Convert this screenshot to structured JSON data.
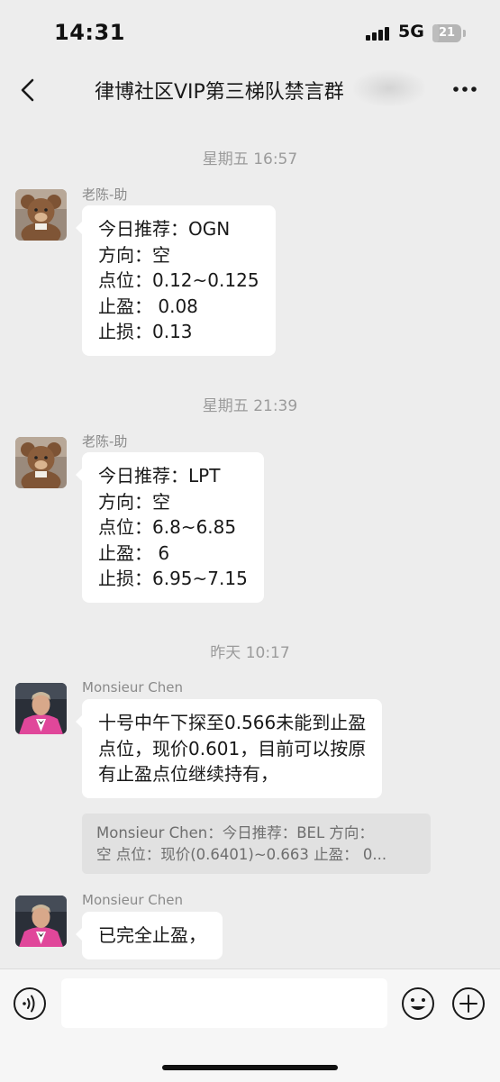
{
  "status_bar": {
    "time": "14:31",
    "network": "5G",
    "battery": "21",
    "battery_level": 0.21
  },
  "nav": {
    "title": "律博社区VIP第三梯队禁言群",
    "back_icon": "chevron-left-icon",
    "more_icon": "more-dots-icon"
  },
  "messages": [
    {
      "timestamp": "星期五 16:57",
      "sender": "老陈-助",
      "avatar": "teddy-bear-avatar",
      "lines": [
        "今日推荐：OGN",
        "方向：空",
        "点位：0.12~0.125",
        "止盈： 0.08",
        "止损：0.13"
      ]
    },
    {
      "timestamp": "星期五 21:39",
      "sender": "老陈-助",
      "avatar": "teddy-bear-avatar",
      "lines": [
        "今日推荐：LPT",
        "方向：空",
        "点位：6.8~6.85",
        "止盈： 6",
        "止损：6.95~7.15"
      ]
    },
    {
      "timestamp": "昨天 10:17",
      "sender": "Monsieur Chen",
      "avatar": "man-in-pink-suit-avatar",
      "lines": [
        "十号中午下探至0.566未能到止盈",
        "点位，现价0.601，目前可以按原",
        "有止盈点位继续持有，"
      ],
      "quote": [
        "Monsieur Chen：今日推荐：BEL 方向：",
        "空 点位：现价(0.6401)~0.663 止盈： 0..."
      ]
    },
    {
      "sender": "Monsieur Chen",
      "avatar": "man-in-pink-suit-avatar",
      "lines": [
        "已完全止盈，"
      ]
    }
  ],
  "input_bar": {
    "voice_icon": "voice-input-icon",
    "input_value": "",
    "emoji_icon": "emoji-icon",
    "plus_icon": "plus-icon"
  }
}
